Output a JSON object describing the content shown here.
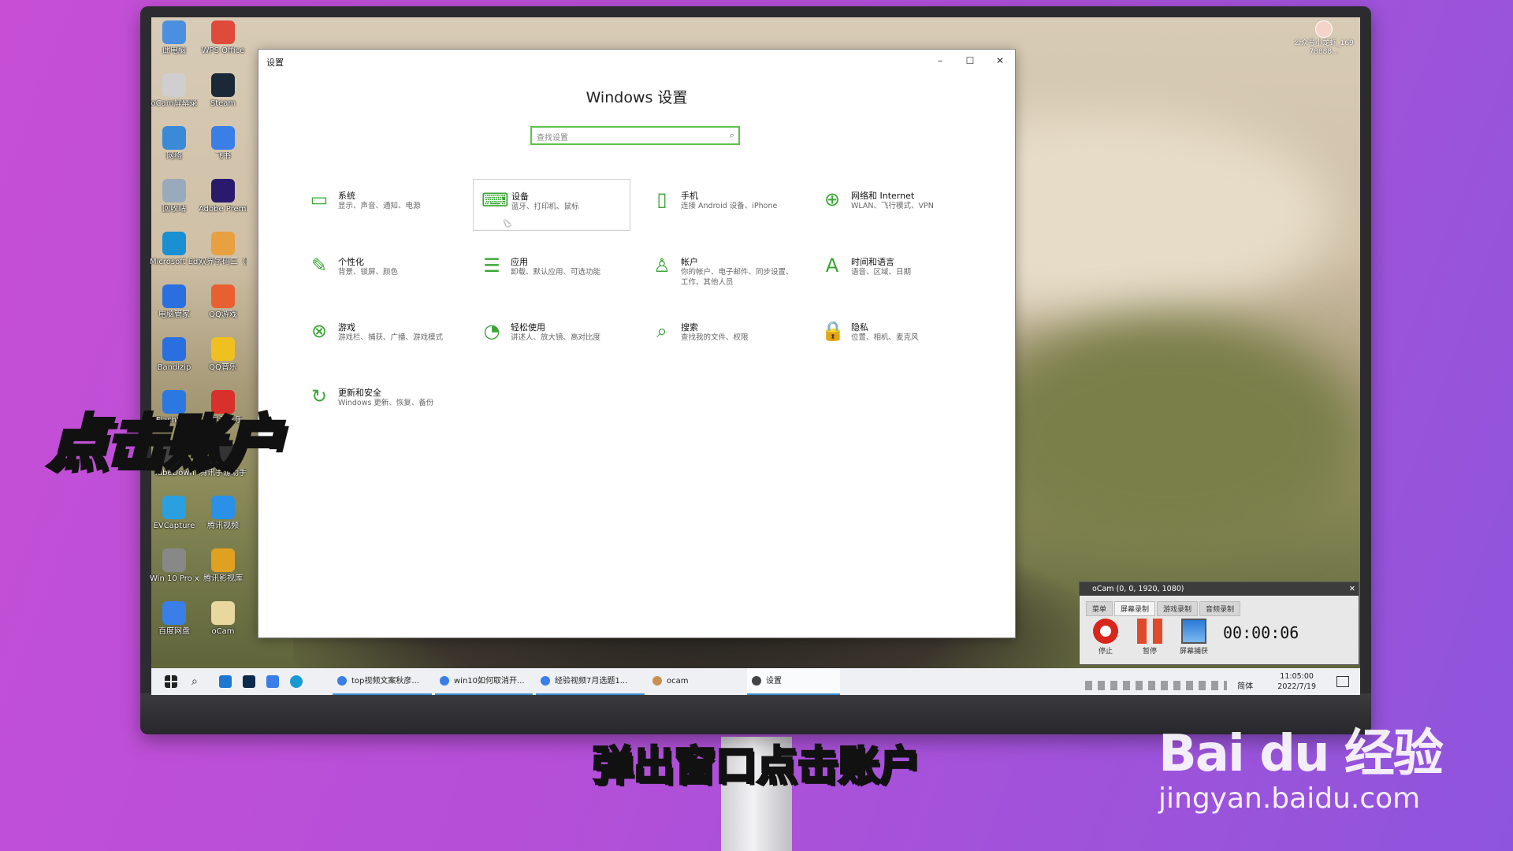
{
  "desktop_icons": [
    {
      "label": "此电脑",
      "color": "#4a8fe0"
    },
    {
      "label": "WPS Office",
      "color": "#e04a3a"
    },
    {
      "label": "oCam屏幕录",
      "color": "#cfcfcf"
    },
    {
      "label": "Steam",
      "color": "#1b2838"
    },
    {
      "label": "网络",
      "color": "#3b8ad8"
    },
    {
      "label": "飞书",
      "color": "#3a7ee8"
    },
    {
      "label": "回收站",
      "color": "#9ab"
    },
    {
      "label": "Adobe Premie...",
      "color": "#2a1a6e"
    },
    {
      "label": "Microsoft Edge",
      "color": "#1a8fd2"
    },
    {
      "label": "双界字码三（限",
      "color": "#e8a040"
    },
    {
      "label": "电脑管家",
      "color": "#2a6fe0"
    },
    {
      "label": "QQ游戏",
      "color": "#e86030"
    },
    {
      "label": "Bandizip",
      "color": "#2a6fe0"
    },
    {
      "label": "QQ音乐",
      "color": "#f0c020"
    },
    {
      "label": "Flash中心",
      "color": "#2a78e0"
    },
    {
      "label": "网易云音乐",
      "color": "#d8302a"
    },
    {
      "label": "TubeDown",
      "color": "#444"
    },
    {
      "label": "腾讯手游助手",
      "color": "#333"
    },
    {
      "label": "EVCapture",
      "color": "#2aa0e0"
    },
    {
      "label": "腾讯视频",
      "color": "#2a90e8"
    },
    {
      "label": "Win 10 Pro x64 (C)",
      "color": "#888"
    },
    {
      "label": "腾讯影视库",
      "color": "#e0a020"
    },
    {
      "label": "百度网盘",
      "color": "#3a7ee8"
    },
    {
      "label": "oCam",
      "color": "#e8d8a0"
    }
  ],
  "top_right_user": "公众号小龙虾_16978888...",
  "settings": {
    "window_title": "设置",
    "heading": "Windows 设置",
    "search_placeholder": "查找设置",
    "controls": {
      "minimize": "–",
      "maximize": "☐",
      "close": "✕"
    },
    "tiles": [
      {
        "title": "系统",
        "sub": "显示、声音、通知、电源",
        "icon": "laptop-icon",
        "glyph": "▭"
      },
      {
        "title": "设备",
        "sub": "蓝牙、打印机、鼠标",
        "icon": "keyboard-icon",
        "glyph": "⌨"
      },
      {
        "title": "手机",
        "sub": "连接 Android 设备、iPhone",
        "icon": "phone-icon",
        "glyph": "▯"
      },
      {
        "title": "网络和 Internet",
        "sub": "WLAN、飞行模式、VPN",
        "icon": "globe-icon",
        "glyph": "⊕"
      },
      {
        "title": "个性化",
        "sub": "背景、锁屏、颜色",
        "icon": "brush-icon",
        "glyph": "✎"
      },
      {
        "title": "应用",
        "sub": "卸载、默认应用、可选功能",
        "icon": "apps-list-icon",
        "glyph": "☰"
      },
      {
        "title": "帐户",
        "sub": "你的帐户、电子邮件、同步设置、工作、其他人员",
        "icon": "person-icon",
        "glyph": "♙"
      },
      {
        "title": "时间和语言",
        "sub": "语音、区域、日期",
        "icon": "time-language-icon",
        "glyph": "A"
      },
      {
        "title": "游戏",
        "sub": "游戏栏、捕获、广播、游戏模式",
        "icon": "xbox-icon",
        "glyph": "⊗"
      },
      {
        "title": "轻松使用",
        "sub": "讲述人、放大镜、高对比度",
        "icon": "ease-of-access-icon",
        "glyph": "◔"
      },
      {
        "title": "搜索",
        "sub": "查找我的文件、权限",
        "icon": "search-icon",
        "glyph": "⌕"
      },
      {
        "title": "隐私",
        "sub": "位置、相机、麦克风",
        "icon": "lock-icon",
        "glyph": "🔒"
      },
      {
        "title": "更新和安全",
        "sub": "Windows 更新、恢复、备份",
        "icon": "update-icon",
        "glyph": "↻"
      }
    ]
  },
  "taskbar": {
    "tasks": [
      "top视频文案秋彦...",
      "win10如何取消开...",
      "经验视频7月选题1...",
      "ocam",
      "设置"
    ],
    "ime": "简体",
    "time": "11:05:00",
    "date": "2022/7/19"
  },
  "ocam": {
    "title": "oCam (0, 0, 1920, 1080)",
    "tabs": [
      "菜单",
      "屏幕录制",
      "游戏录制",
      "音频录制"
    ],
    "buttons": [
      "停止",
      "暂停",
      "屏幕捕获"
    ],
    "timer": "00:00:06"
  },
  "overlay": {
    "caption": "点击账户",
    "subtitle": "弹出窗口点击账户"
  },
  "watermark": {
    "logo": "Bai du 经验",
    "url": "jingyan.baidu.com"
  }
}
